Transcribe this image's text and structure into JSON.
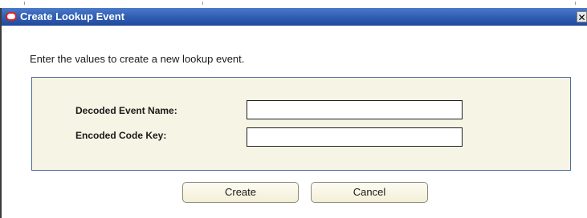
{
  "dialog": {
    "title": "Create Lookup Event",
    "close_symbol": "✕",
    "instruction": "Enter the values to create a new lookup event."
  },
  "form": {
    "decoded_event_name_label": "Decoded Event Name:",
    "decoded_event_name_value": "",
    "encoded_code_key_label": "Encoded Code Key:",
    "encoded_code_key_value": ""
  },
  "buttons": {
    "create_label": "Create",
    "cancel_label": "Cancel"
  },
  "icons": {
    "logo": "oracle-logo-icon",
    "close": "close-icon"
  },
  "colors": {
    "titlebar": "#2f5fb4",
    "form_background": "#f6f4e4",
    "form_border": "#4a6fa0",
    "logo_red": "#e02020"
  }
}
